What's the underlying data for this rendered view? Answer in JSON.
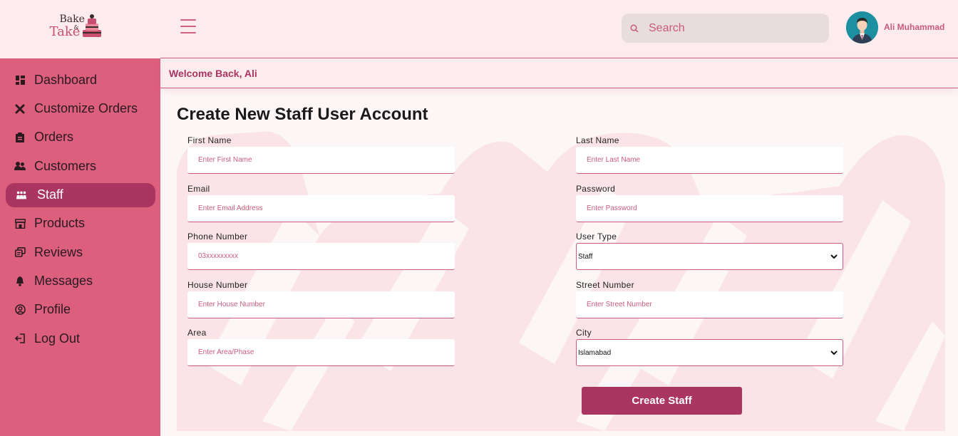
{
  "brand": {
    "logo_line1": "Bake",
    "logo_amp": "&",
    "logo_line2": "Take"
  },
  "sidebar": {
    "items": [
      {
        "label": "Dashboard",
        "icon": "dashboard-icon",
        "active": false
      },
      {
        "label": "Customize Orders",
        "icon": "tools-icon",
        "active": false
      },
      {
        "label": "Orders",
        "icon": "clipboard-icon",
        "active": false
      },
      {
        "label": "Customers",
        "icon": "users-icon",
        "active": false
      },
      {
        "label": "Staff",
        "icon": "staff-icon",
        "active": true
      },
      {
        "label": "Products",
        "icon": "store-icon",
        "active": false
      },
      {
        "label": "Reviews",
        "icon": "reviews-icon",
        "active": false
      },
      {
        "label": "Messages",
        "icon": "bell-icon",
        "active": false
      },
      {
        "label": "Profile",
        "icon": "user-circle-icon",
        "active": false
      },
      {
        "label": "Log Out",
        "icon": "logout-icon",
        "active": false
      }
    ]
  },
  "header": {
    "search_placeholder": "Search",
    "user_name": "Ali Muhammad"
  },
  "welcome": {
    "text": "Welcome Back, Ali"
  },
  "form": {
    "title": "Create New Staff User Account",
    "first_name": {
      "label": "First Name",
      "placeholder": "Enter First Name"
    },
    "last_name": {
      "label": "Last Name",
      "placeholder": "Enter Last Name"
    },
    "email": {
      "label": "Email",
      "placeholder": "Enter Email Address"
    },
    "password": {
      "label": "Password",
      "placeholder": "Enter Password"
    },
    "phone": {
      "label": "Phone Number",
      "placeholder": "03xxxxxxxxx"
    },
    "user_type": {
      "label": "User Type",
      "value": "Staff"
    },
    "house": {
      "label": "House Number",
      "placeholder": "Enter House Number"
    },
    "street": {
      "label": "Street Number",
      "placeholder": "Enter Street Number"
    },
    "area": {
      "label": "Area",
      "placeholder": "Enter Area/Phase"
    },
    "city": {
      "label": "City",
      "value": "Islamabad"
    },
    "submit_label": "Create Staff"
  },
  "colors": {
    "sidebar": "#dc5f7d",
    "active": "#a93560",
    "header_bg": "#fdecee",
    "accent": "#c85c7a"
  }
}
